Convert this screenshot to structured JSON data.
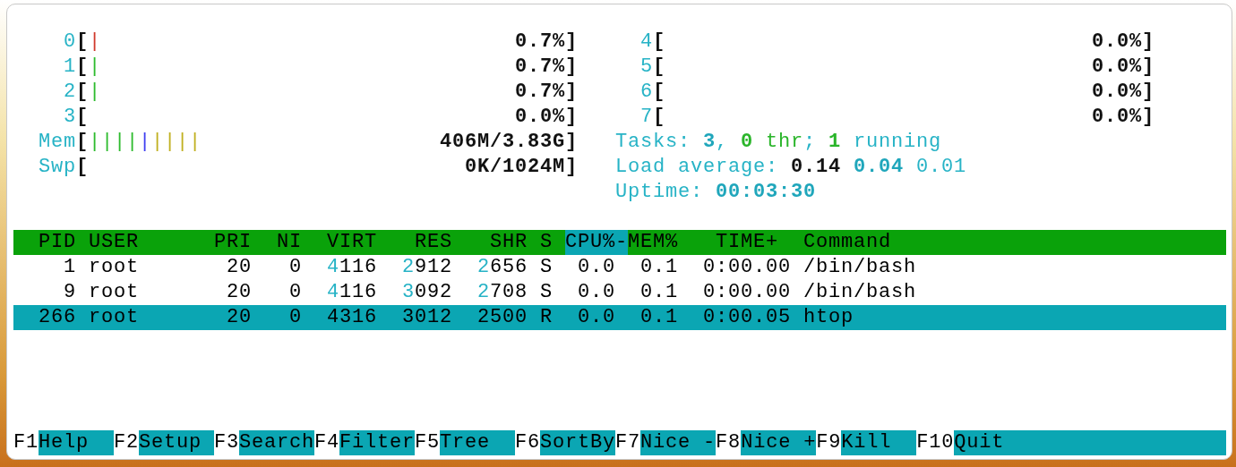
{
  "meters_left": [
    {
      "label": "0",
      "open": "[",
      "segments": [
        {
          "color": "#d0392b",
          "text": "|"
        }
      ],
      "value": "0.7%",
      "close": "]"
    },
    {
      "label": "1",
      "open": "[",
      "segments": [
        {
          "color": "#2dbb2d",
          "text": "|"
        }
      ],
      "value": "0.7%",
      "close": "]"
    },
    {
      "label": "2",
      "open": "[",
      "segments": [
        {
          "color": "#2dbb2d",
          "text": "|"
        }
      ],
      "value": "0.7%",
      "close": "]"
    },
    {
      "label": "3",
      "open": "[",
      "value": "0.0%",
      "close": "]"
    },
    {
      "label": "Mem",
      "open": "[",
      "segments": [
        {
          "color": "#2dbb2d",
          "text": "||||"
        },
        {
          "color": "#3d3df0",
          "text": "|"
        },
        {
          "color": "#c0b020",
          "text": "||||"
        }
      ],
      "value": "406M/3.83G",
      "close": "]"
    },
    {
      "label": "Swp",
      "open": "[",
      "value": "0K/1024M",
      "close": "]"
    }
  ],
  "meters_right": [
    {
      "label": "4",
      "open": "[",
      "value": "0.0%",
      "close": "]"
    },
    {
      "label": "5",
      "open": "[",
      "value": "0.0%",
      "close": "]"
    },
    {
      "label": "6",
      "open": "[",
      "value": "0.0%",
      "close": "]"
    },
    {
      "label": "7",
      "open": "[",
      "value": "0.0%",
      "close": "]"
    }
  ],
  "summary": [
    {
      "parts": [
        {
          "text": "Tasks: ",
          "kind": "label"
        },
        {
          "text": "3",
          "kind": "strong"
        },
        {
          "text": ", ",
          "kind": "label"
        },
        {
          "text": "0",
          "kind": "green_strong"
        },
        {
          "text": " thr",
          "kind": "green"
        },
        {
          "text": "; ",
          "kind": "label"
        },
        {
          "text": "1",
          "kind": "green_strong"
        },
        {
          "text": " running",
          "kind": "label"
        }
      ]
    },
    {
      "parts": [
        {
          "text": "Load average: ",
          "kind": "label"
        },
        {
          "text": "0.14",
          "kind": "dark_strong"
        },
        {
          "text": " 0.04",
          "kind": "strong"
        },
        {
          "text": " 0.01",
          "kind": "label"
        }
      ]
    },
    {
      "parts": [
        {
          "text": "Uptime: ",
          "kind": "label"
        },
        {
          "text": "00:03:30",
          "kind": "strong"
        }
      ]
    }
  ],
  "table": {
    "columns": [
      {
        "label": "PID",
        "selected": false
      },
      {
        "label": "USER",
        "selected": false
      },
      {
        "label": "PRI",
        "selected": false
      },
      {
        "label": "NI",
        "selected": false
      },
      {
        "label": "VIRT",
        "selected": false
      },
      {
        "label": "RES",
        "selected": false
      },
      {
        "label": "SHR",
        "selected": false
      },
      {
        "label": "S",
        "selected": false
      },
      {
        "label": "CPU%-",
        "selected": true
      },
      {
        "label": "MEM%",
        "selected": false
      },
      {
        "label": "TIME+",
        "selected": false
      },
      {
        "label": "Command",
        "selected": false
      }
    ],
    "rows": [
      {
        "selected": false,
        "cells": [
          "1",
          "root",
          "20",
          "0",
          "4116",
          "2912",
          "2656",
          "S",
          "0.0",
          "0.1",
          "0:00.00",
          "/bin/bash"
        ]
      },
      {
        "selected": false,
        "cells": [
          "9",
          "root",
          "20",
          "0",
          "4116",
          "3092",
          "2708",
          "S",
          "0.0",
          "0.1",
          "0:00.00",
          "/bin/bash"
        ]
      },
      {
        "selected": true,
        "cells": [
          "266",
          "root",
          "20",
          "0",
          "4316",
          "3012",
          "2500",
          "R",
          "0.0",
          "0.1",
          "0:00.05",
          "htop"
        ]
      }
    ]
  },
  "function_keys": [
    {
      "key": "F1",
      "label": "Help"
    },
    {
      "key": "F2",
      "label": "Setup"
    },
    {
      "key": "F3",
      "label": "Search"
    },
    {
      "key": "F4",
      "label": "Filter"
    },
    {
      "key": "F5",
      "label": "Tree"
    },
    {
      "key": "F6",
      "label": "SortBy"
    },
    {
      "key": "F7",
      "label": "Nice -"
    },
    {
      "key": "F8",
      "label": "Nice +"
    },
    {
      "key": "F9",
      "label": "Kill"
    },
    {
      "key": "F10",
      "label": "Quit"
    }
  ]
}
